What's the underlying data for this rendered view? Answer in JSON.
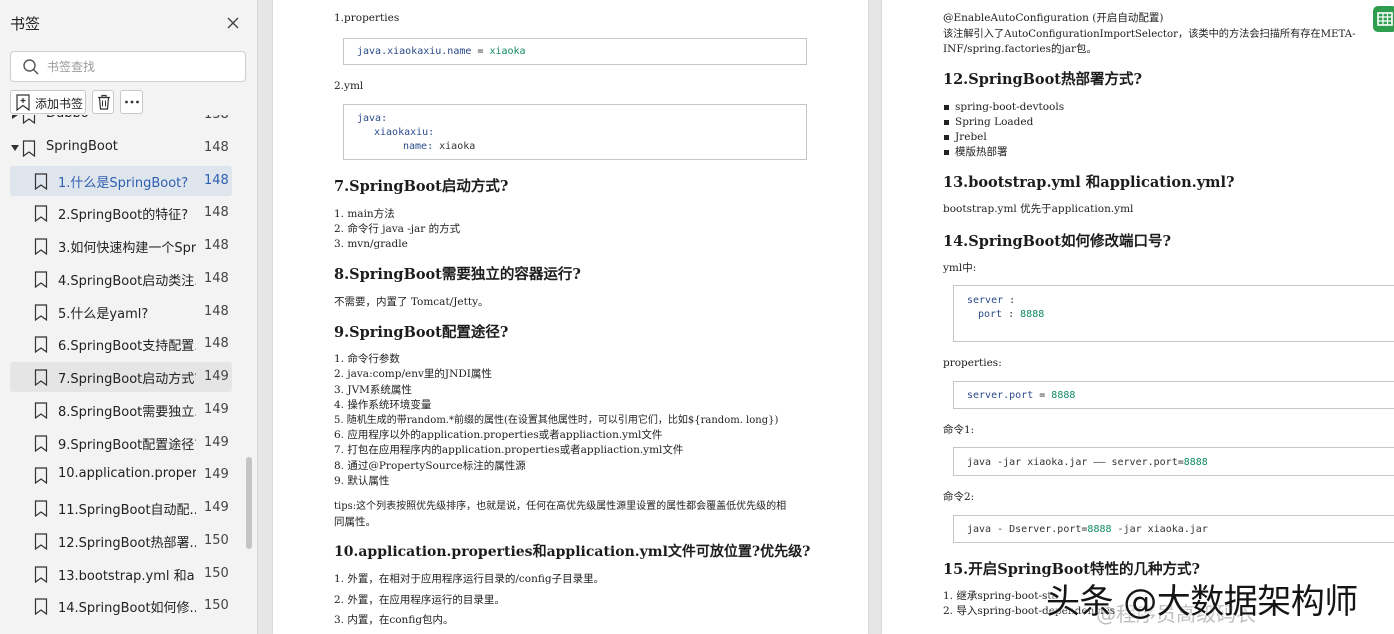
{
  "sidebar": {
    "title": "书签",
    "search_placeholder": "书签查找",
    "add_label": "添加书签",
    "items": [
      {
        "label": "Dubbo",
        "page": "138",
        "level": 0,
        "expand": "collapsed"
      },
      {
        "label": "SpringBoot",
        "page": "148",
        "level": 0,
        "expand": "expanded"
      },
      {
        "label": "1.什么是SpringBoot?",
        "page": "148",
        "level": 1,
        "state": "selected"
      },
      {
        "label": "2.SpringBoot的特征?",
        "page": "148",
        "level": 1
      },
      {
        "label": "3.如何快速构建一个Spr...",
        "page": "148",
        "level": 1
      },
      {
        "label": "4.SpringBoot启动类注...",
        "page": "148",
        "level": 1
      },
      {
        "label": "5.什么是yaml?",
        "page": "148",
        "level": 1
      },
      {
        "label": "6.SpringBoot支持配置...",
        "page": "148",
        "level": 1
      },
      {
        "label": "7.SpringBoot启动方式?",
        "page": "149",
        "level": 1,
        "state": "current"
      },
      {
        "label": "8.SpringBoot需要独立...",
        "page": "149",
        "level": 1
      },
      {
        "label": "9.SpringBoot配置途径?",
        "page": "149",
        "level": 1
      },
      {
        "label": "10.application.proper...",
        "page": "149",
        "level": 1
      },
      {
        "label": "11.SpringBoot自动配...",
        "page": "149",
        "level": 1
      },
      {
        "label": "12.SpringBoot热部署...",
        "page": "150",
        "level": 1
      },
      {
        "label": "13.bootstrap.yml 和a...",
        "page": "150",
        "level": 1
      },
      {
        "label": "14.SpringBoot如何修...",
        "page": "150",
        "level": 1
      }
    ]
  },
  "left_page": {
    "l_properties": "1.properties",
    "code1": {
      "key": "java.xiaokaxiu.name",
      "op": " = ",
      "val": "xiaoka"
    },
    "l_yml": "2.yml",
    "code2": {
      "l1": "java:",
      "l2": "xiaokaxiu:",
      "l3k": "name:",
      "l3v": " xiaoka"
    },
    "h7": "7.SpringBoot启动方式?",
    "list7": [
      "1.  main方法",
      "2.  命令行 java -jar 的方式",
      "3.  mvn/gradle"
    ],
    "h8": "8.SpringBoot需要独立的容器运行?",
    "p8": "不需要，内置了 Tomcat/Jetty。",
    "h9": "9.SpringBoot配置途径?",
    "list9": [
      "1.  命令行参数",
      "2.  java:comp/env里的JNDI属性",
      "3.  JVM系统属性",
      "4.  操作系统环境变量",
      "5.  随机生成的带random.*前缀的属性(在设置其他属性时，可以引用它们，比如${random. long})",
      "6.  应用程序以外的application.properties或者appliaction.yml文件",
      "7.  打包在应用程序内的application.properties或者appliaction.yml文件",
      "8.  通过@PropertySource标注的属性源",
      "9.  默认属性"
    ],
    "tips1": "tips:这个列表按照优先级排序，也就是说，任何在高优先级属性源里设置的属性都会覆盖低优先级的相",
    "tips2": "同属性。",
    "h10": "10.application.properties和application.yml文件可放位置?优先级?",
    "list10": [
      "1.  外置，在相对于应用程序运行目录的/config子目录里。",
      "2.  外置，在应用程序运行的目录里。",
      "3.  内置，在config包内。"
    ]
  },
  "right_page": {
    "p1": "@EnableAutoConfiguration (开启自动配置)",
    "p2": "该注解引入了AutoConfigurationImportSelector，该类中的方法会扫描所有存在META-",
    "p3": "INF/spring.factories的jar包。",
    "h12": "12.SpringBoot热部署方式?",
    "bullets": [
      "spring-boot-devtools",
      "Spring Loaded",
      "Jrebel",
      "模版热部署"
    ],
    "h13": "13.bootstrap.yml 和application.yml?",
    "p13": "bootstrap.yml 优先于application.yml",
    "h14": "14.SpringBoot如何修改端口号?",
    "yml_label": "yml中:",
    "code_yml": {
      "k1": "server",
      "s1": " :",
      "k2": "port",
      "s2": " : ",
      "v2": "8888"
    },
    "prop_label": "properties:",
    "code_prop": {
      "k": "server.port",
      "op": " = ",
      "v": "8888"
    },
    "cmd1_label": "命令1:",
    "cmd1": {
      "a": "java -jar xiaoka.jar —— server.port=",
      "v": "8888"
    },
    "cmd2_label": "命令2:",
    "cmd2": {
      "a": "java - Dserver.port=",
      "v": "8888",
      "b": " -jar xiaoka.jar"
    },
    "h15": "15.开启SpringBoot特性的几种方式?",
    "list15": [
      "1.  继承spring-boot-sta",
      "2.  导入spring-boot-dependencies"
    ]
  },
  "watermark": {
    "main": "头条 @大数据架构师",
    "faint": "@程序员高级码农"
  },
  "colors": {
    "selected_text": "#2f5fb0",
    "selected_bg": "#dfe5ed",
    "code_key": "#2a4a8a",
    "code_value": "#0f8a66",
    "app_icon": "#2e9e4e"
  }
}
